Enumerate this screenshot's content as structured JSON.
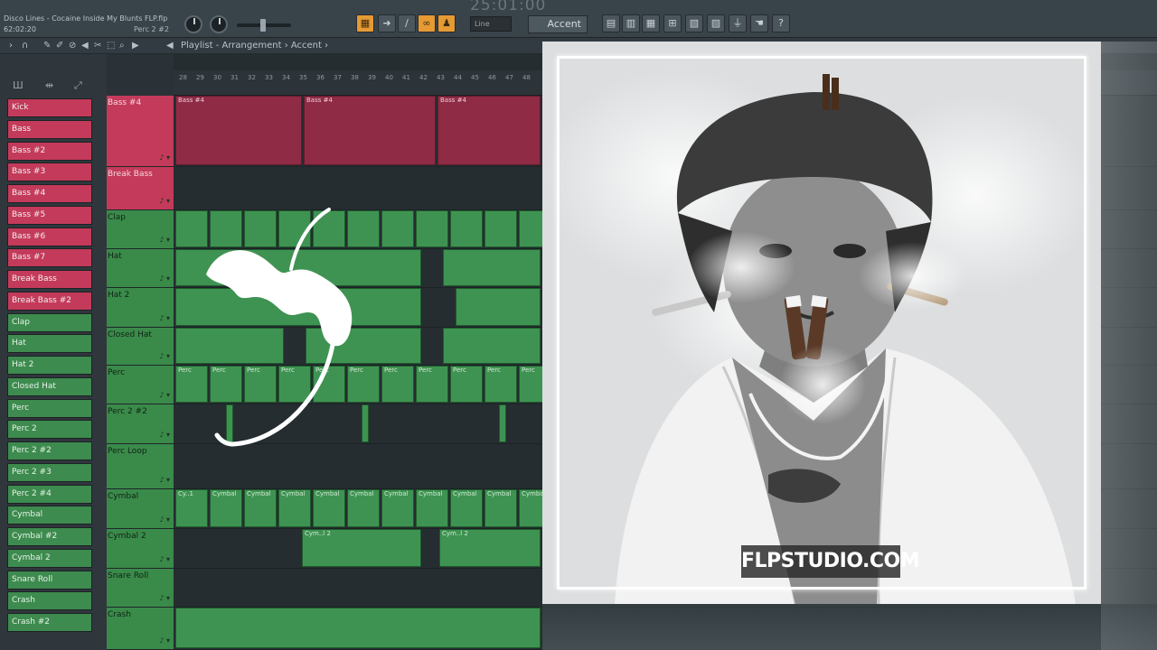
{
  "project": {
    "name": "Disco Lines - Cocaine Inside My Blunts FLP.flp",
    "time": "62:02:20",
    "selected": "Perc 2 #2",
    "song_time": "25:01:00"
  },
  "top_controls": {
    "snap_value": "Line",
    "pattern_select": "Accent"
  },
  "breadcrumb": "Playlist - Arrangement › Accent ›",
  "ruler": {
    "bars": [
      "28",
      "29",
      "30",
      "31",
      "32",
      "33",
      "34",
      "35",
      "36",
      "37",
      "38",
      "39",
      "40",
      "41",
      "42",
      "43",
      "44",
      "45",
      "46",
      "47",
      "48"
    ]
  },
  "channels": [
    {
      "label": "Kick",
      "color": "pink"
    },
    {
      "label": "Bass",
      "color": "pink"
    },
    {
      "label": "Bass #2",
      "color": "pink"
    },
    {
      "label": "Bass #3",
      "color": "pink"
    },
    {
      "label": "Bass #4",
      "color": "pink"
    },
    {
      "label": "Bass #5",
      "color": "pink"
    },
    {
      "label": "Bass #6",
      "color": "pink"
    },
    {
      "label": "Bass #7",
      "color": "pink"
    },
    {
      "label": "Break Bass",
      "color": "pink"
    },
    {
      "label": "Break Bass #2",
      "color": "pink"
    },
    {
      "label": "Clap",
      "color": "green"
    },
    {
      "label": "Hat",
      "color": "green"
    },
    {
      "label": "Hat 2",
      "color": "green"
    },
    {
      "label": "Closed Hat",
      "color": "green"
    },
    {
      "label": "Perc",
      "color": "green"
    },
    {
      "label": "Perc 2",
      "color": "green"
    },
    {
      "label": "Perc 2 #2",
      "color": "green"
    },
    {
      "label": "Perc 2 #3",
      "color": "green"
    },
    {
      "label": "Perc 2 #4",
      "color": "green"
    },
    {
      "label": "Cymbal",
      "color": "green"
    },
    {
      "label": "Cymbal #2",
      "color": "green"
    },
    {
      "label": "Cymbal 2",
      "color": "green"
    },
    {
      "label": "Snare Roll",
      "color": "green"
    },
    {
      "label": "Crash",
      "color": "green"
    },
    {
      "label": "Crash #2",
      "color": "green"
    }
  ],
  "tracks": [
    {
      "label": "Bass #4",
      "color": "pink"
    },
    {
      "label": "Break Bass",
      "color": "pink"
    },
    {
      "label": "Clap",
      "color": "green"
    },
    {
      "label": "Hat",
      "color": "green"
    },
    {
      "label": "Hat 2",
      "color": "green"
    },
    {
      "label": "Closed Hat",
      "color": "green"
    },
    {
      "label": "Perc",
      "color": "green"
    },
    {
      "label": "Perc 2 #2",
      "color": "green"
    },
    {
      "label": "Perc Loop",
      "color": "green"
    },
    {
      "label": "Cymbal",
      "color": "green"
    },
    {
      "label": "Cymbal 2",
      "color": "green"
    },
    {
      "label": "Snare Roll",
      "color": "green"
    },
    {
      "label": "Crash",
      "color": "green"
    }
  ],
  "clip_labels": {
    "bass4": "Bass #4",
    "perc": "Perc",
    "cymbal": "Cymbal",
    "cymbal_short": "Cy..1",
    "cym2": "Cym..l 2"
  },
  "watermark": "FLPSTUDIO.COM",
  "colors": {
    "pink": "#c43a5a",
    "green": "#3d8b4e",
    "accent": "#e59a34"
  }
}
